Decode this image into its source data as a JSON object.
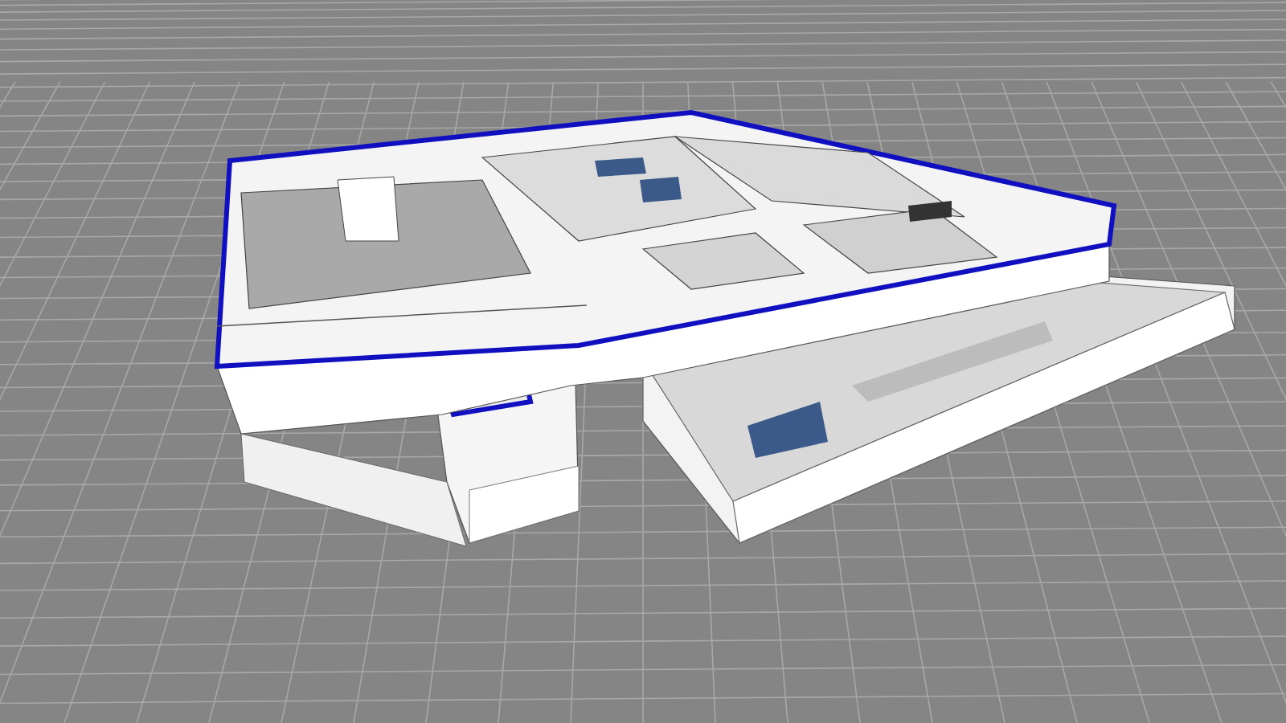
{
  "scene": {
    "kind": "building-model"
  }
}
